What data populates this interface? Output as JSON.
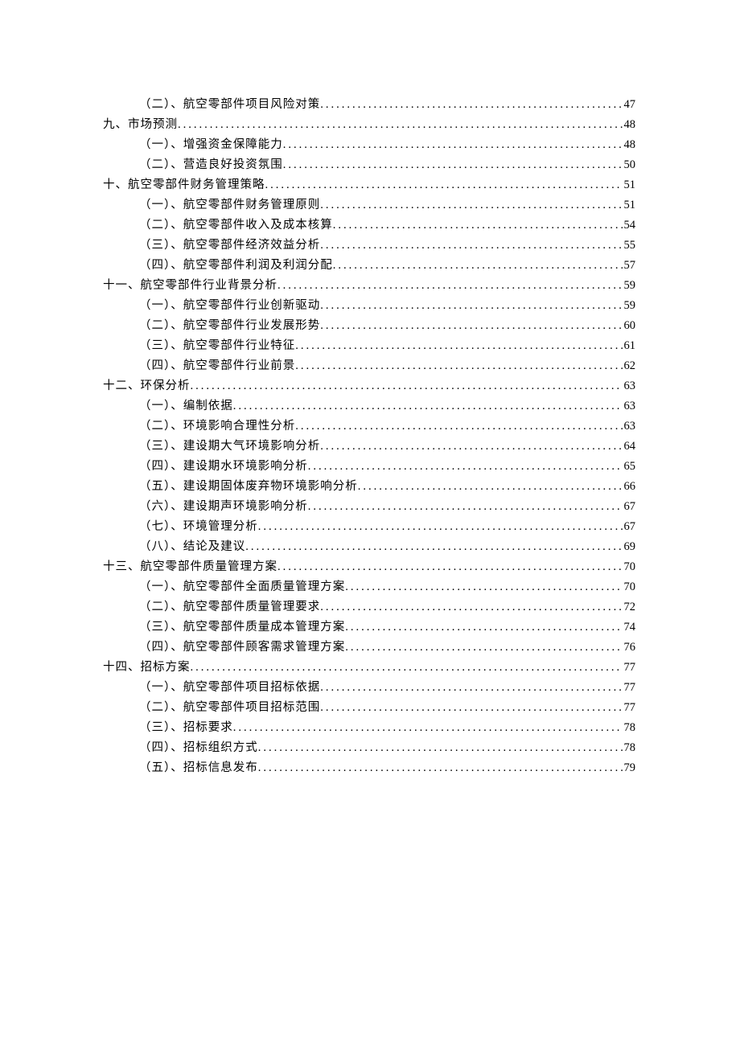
{
  "toc": [
    {
      "level": 2,
      "label": "（二）、航空零部件项目风险对策",
      "page": "47"
    },
    {
      "level": 1,
      "label": "九、市场预测",
      "page": "48"
    },
    {
      "level": 2,
      "label": "（一）、增强资金保障能力",
      "page": "48"
    },
    {
      "level": 2,
      "label": "（二）、营造良好投资氛围",
      "page": "50"
    },
    {
      "level": 1,
      "label": "十、航空零部件财务管理策略",
      "page": "51"
    },
    {
      "level": 2,
      "label": "（一）、航空零部件财务管理原则",
      "page": "51"
    },
    {
      "level": 2,
      "label": "（二）、航空零部件收入及成本核算",
      "page": "54"
    },
    {
      "level": 2,
      "label": "（三）、航空零部件经济效益分析",
      "page": "55"
    },
    {
      "level": 2,
      "label": "（四）、航空零部件利润及利润分配",
      "page": "57"
    },
    {
      "level": 1,
      "label": "十一、航空零部件行业背景分析",
      "page": "59"
    },
    {
      "level": 2,
      "label": "（一）、航空零部件行业创新驱动",
      "page": "59"
    },
    {
      "level": 2,
      "label": "（二）、航空零部件行业发展形势",
      "page": "60"
    },
    {
      "level": 2,
      "label": "（三）、航空零部件行业特征",
      "page": "61"
    },
    {
      "level": 2,
      "label": "（四）、航空零部件行业前景",
      "page": "62"
    },
    {
      "level": 1,
      "label": "十二、环保分析",
      "page": "63"
    },
    {
      "level": 2,
      "label": "（一）、编制依据",
      "page": "63"
    },
    {
      "level": 2,
      "label": "（二）、环境影响合理性分析",
      "page": "63"
    },
    {
      "level": 2,
      "label": "（三）、建设期大气环境影响分析",
      "page": "64"
    },
    {
      "level": 2,
      "label": "（四）、建设期水环境影响分析",
      "page": "65"
    },
    {
      "level": 2,
      "label": "（五）、建设期固体废弃物环境影响分析",
      "page": "66"
    },
    {
      "level": 2,
      "label": "（六）、建设期声环境影响分析",
      "page": "67"
    },
    {
      "level": 2,
      "label": "（七）、环境管理分析",
      "page": "67"
    },
    {
      "level": 2,
      "label": "（八）、结论及建议",
      "page": "69"
    },
    {
      "level": 1,
      "label": "十三、航空零部件质量管理方案",
      "page": "70"
    },
    {
      "level": 2,
      "label": "（一）、航空零部件全面质量管理方案",
      "page": "70"
    },
    {
      "level": 2,
      "label": "（二）、航空零部件质量管理要求",
      "page": "72"
    },
    {
      "level": 2,
      "label": "（三）、航空零部件质量成本管理方案",
      "page": "74"
    },
    {
      "level": 2,
      "label": "（四）、航空零部件顾客需求管理方案",
      "page": "76"
    },
    {
      "level": 1,
      "label": "十四、招标方案",
      "page": "77"
    },
    {
      "level": 2,
      "label": "（一）、航空零部件项目招标依据",
      "page": "77"
    },
    {
      "level": 2,
      "label": "（二）、航空零部件项目招标范围",
      "page": "77"
    },
    {
      "level": 2,
      "label": "（三）、招标要求",
      "page": "78"
    },
    {
      "level": 2,
      "label": "（四）、招标组织方式",
      "page": "78"
    },
    {
      "level": 2,
      "label": "（五）、招标信息发布",
      "page": "79"
    }
  ]
}
